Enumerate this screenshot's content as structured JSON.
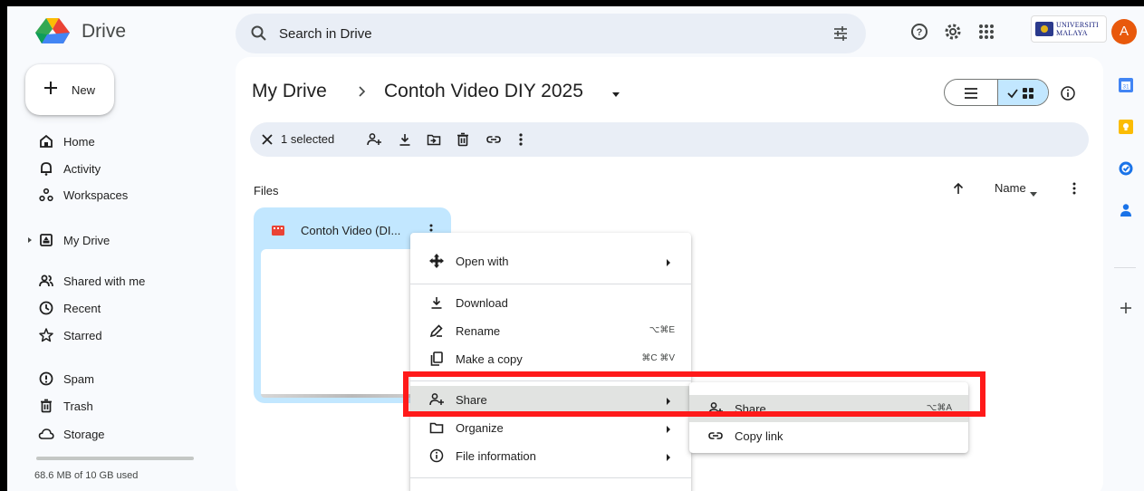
{
  "app": {
    "name": "Drive"
  },
  "search": {
    "placeholder": "Search in Drive"
  },
  "org": {
    "line1": "UNIVERSITI",
    "line2": "MALAYA"
  },
  "avatar": {
    "letter": "A",
    "color": "#e8590c"
  },
  "sidebar": {
    "new_label": "New",
    "items": [
      {
        "label": "Home",
        "icon": "home-icon"
      },
      {
        "label": "Activity",
        "icon": "bell-icon"
      },
      {
        "label": "Workspaces",
        "icon": "workspaces-icon"
      },
      {
        "label": "My Drive",
        "icon": "my-drive-icon"
      },
      {
        "label": "Shared with me",
        "icon": "people-icon"
      },
      {
        "label": "Recent",
        "icon": "clock-icon"
      },
      {
        "label": "Starred",
        "icon": "star-icon"
      },
      {
        "label": "Spam",
        "icon": "spam-icon"
      },
      {
        "label": "Trash",
        "icon": "trash-icon"
      },
      {
        "label": "Storage",
        "icon": "cloud-icon"
      }
    ],
    "storage_text": "68.6 MB of 10 GB used",
    "storage_used_fraction": 0.0069
  },
  "breadcrumb": {
    "root": "My Drive",
    "current": "Contoh Video DIY 2025"
  },
  "selection": {
    "count_label": "1 selected"
  },
  "files": {
    "heading": "Files",
    "sort_label": "Name",
    "items": [
      {
        "name": "Contoh Video (DI...",
        "type": "video"
      }
    ]
  },
  "context_menu": {
    "items": [
      {
        "label": "Open with",
        "icon": "open-with-icon",
        "submenu": true
      },
      {
        "label": "Download",
        "icon": "download-icon"
      },
      {
        "label": "Rename",
        "icon": "rename-icon",
        "shortcut": "⌥⌘E"
      },
      {
        "label": "Make a copy",
        "icon": "copy-icon",
        "shortcut": "⌘C ⌘V"
      },
      {
        "label": "Share",
        "icon": "share-icon",
        "submenu": true
      },
      {
        "label": "Organize",
        "icon": "organize-icon",
        "submenu": true
      },
      {
        "label": "File information",
        "icon": "info-icon",
        "submenu": true
      }
    ]
  },
  "share_submenu": {
    "items": [
      {
        "label": "Share",
        "icon": "share-icon",
        "shortcut": "⌥⌘A"
      },
      {
        "label": "Copy link",
        "icon": "link-icon"
      }
    ]
  },
  "colors": {
    "accent": "#c2e7ff",
    "highlight": "#ff1a1a",
    "surface": "#f8fafd",
    "search_bg": "#e9eef6"
  }
}
